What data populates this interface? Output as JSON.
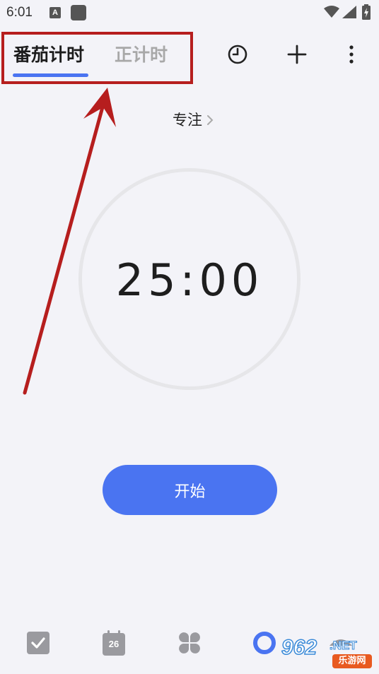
{
  "status_bar": {
    "time": "6:01",
    "notification_letter": "A"
  },
  "header": {
    "tabs": [
      {
        "label": "番茄计时",
        "active": true
      },
      {
        "label": "正计时",
        "active": false
      }
    ],
    "icons": [
      "clock-icon",
      "plus-icon",
      "more-vertical-icon"
    ]
  },
  "focus": {
    "label": "专注"
  },
  "timer": {
    "display": "25:00"
  },
  "start_button": {
    "label": "开始"
  },
  "bottom_nav": {
    "items": [
      {
        "icon": "checkbox-icon"
      },
      {
        "icon": "calendar-icon",
        "date": "26"
      },
      {
        "icon": "clover-grid-icon"
      },
      {
        "icon": "pomodoro-ring-icon",
        "active": true
      },
      {
        "icon": "more-icon"
      }
    ]
  },
  "watermark": {
    "brand": "962",
    "suffix": ".NET",
    "site": "乐游网"
  },
  "colors": {
    "accent": "#4a74f1",
    "annotation": "#b61e1e",
    "background": "#f3f3f8"
  }
}
